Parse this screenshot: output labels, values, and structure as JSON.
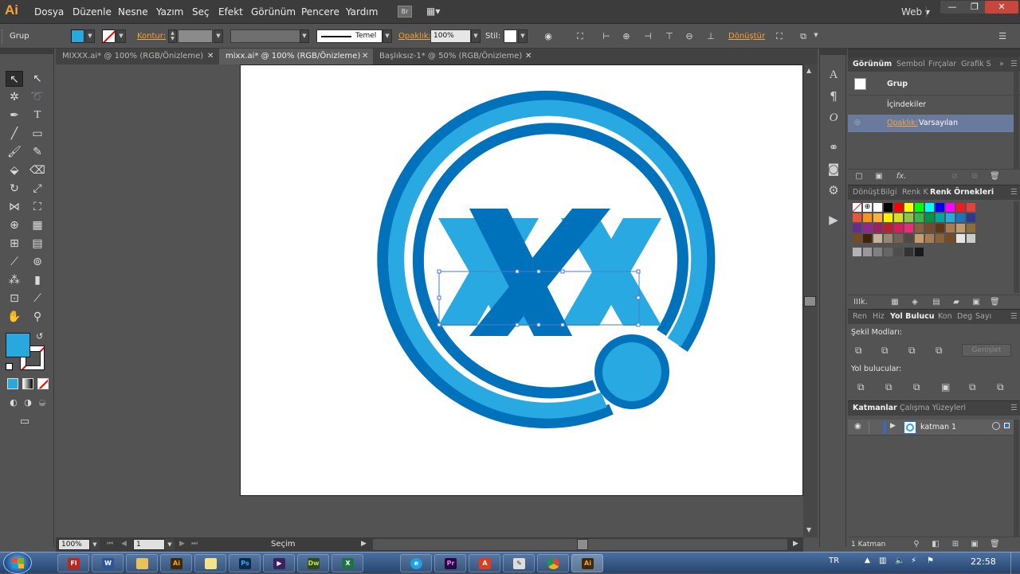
{
  "app": {
    "logo": "Ai",
    "workspace": "Web",
    "workspace_arrow": "▾"
  },
  "menu": [
    "Dosya",
    "Düzenle",
    "Nesne",
    "Yazım",
    "Seç",
    "Efekt",
    "Görünüm",
    "Pencere",
    "Yardım"
  ],
  "menu_badge": "Br",
  "window_controls": {
    "minimize": "—",
    "restore": "❐",
    "close": "✕"
  },
  "control_bar": {
    "selection_type": "Grup",
    "stroke_label": "Kontur:",
    "brush_label": "Temel",
    "opacity_label": "Opaklık:",
    "opacity_value": "100%",
    "style_label": "Stil:",
    "transform_label": "Dönüştür"
  },
  "tabs": [
    {
      "label": "MIXXX.ai* @ 100% (RGB/Önizleme)",
      "close": "✕"
    },
    {
      "label": "mixx.ai* @ 100% (RGB/Önizleme)",
      "close": "✕"
    },
    {
      "label": "Başlıksız-1* @ 50% (RGB/Önizleme)",
      "close": "✕"
    }
  ],
  "status_bar": {
    "zoom": "100%",
    "page": "1",
    "tool": "Seçim"
  },
  "appearance_panel": {
    "tabs": [
      "Görünüm",
      "Sembol",
      "Fırçalar",
      "Grafik S"
    ],
    "item_type": "Grup",
    "contents": "İçindekiler",
    "opacity_label": "Opaklık:",
    "opacity_value": "Varsayılan",
    "fx": "fx."
  },
  "swatches_panel": {
    "tabs": [
      "Dönüşt",
      "Bilgi",
      "Renk K",
      "Renk Örnekleri"
    ],
    "library_label": "IIIk.",
    "swatches": [
      "#ffffff",
      "#000000",
      "#ff0000",
      "#ffff00",
      "#00ff00",
      "#00ffff",
      "#0000ff",
      "#ff00ff",
      "#ed1c24",
      "#e5413b",
      "#e8553b",
      "#f7941d",
      "#fcb040",
      "#fff200",
      "#d7df23",
      "#8dc63f",
      "#39b54a",
      "#009444",
      "#00a79d",
      "#27aae1",
      "#1c75bc",
      "#2b3990",
      "#662d91",
      "#92278f",
      "#9e1f63",
      "#be1e2d",
      "#da1c5c",
      "#ee2a7b",
      "#8b5e3c",
      "#754c29",
      "#603913",
      "#a97c50",
      "#c49a6c",
      "#8a6d3b",
      "#754c24",
      "#42210b",
      "#c7b299",
      "#998675",
      "#736357",
      "#534741",
      "#c69c6d",
      "#a67c52",
      "#8c6239",
      "#754c24",
      "#e6e6e6",
      "#cccccc",
      "#b3b3b3",
      "#999999",
      "#808080",
      "#666666",
      "#4d4d4d",
      "#333333",
      "#1a1a1a"
    ]
  },
  "pathfinder_panel": {
    "tabs": [
      "Ren",
      "Hiz",
      "Yol Bulucu",
      "Kon",
      "Deg",
      "Sayı"
    ],
    "shape_modes_label": "Şekil Modları:",
    "expand_button": "Genişlet",
    "pathfinders_label": "Yol bulucular:"
  },
  "layers_panel": {
    "tabs": [
      "Katmanlar",
      "Çalışma Yüzeyleri"
    ],
    "layers": [
      {
        "name": "katman 1"
      }
    ],
    "count": "1 Katman"
  },
  "colors": {
    "fill": "#29a8e0",
    "logo_dark": "#0072bc",
    "logo_light": "#29a9e1",
    "selection": "#4a7bd0",
    "accent_label": "#f7a23b"
  },
  "taskbar": {
    "apps": [
      "Flash",
      "Word",
      "Explorer",
      "Illustrator",
      "Notes",
      "Photoshop",
      "Premiere",
      "Dreamweaver",
      "Excel",
      "Internet Explorer",
      "Acrobat",
      "Tools",
      "Chrome",
      "Illustrator"
    ],
    "lang": "TR",
    "time": "22:58"
  }
}
